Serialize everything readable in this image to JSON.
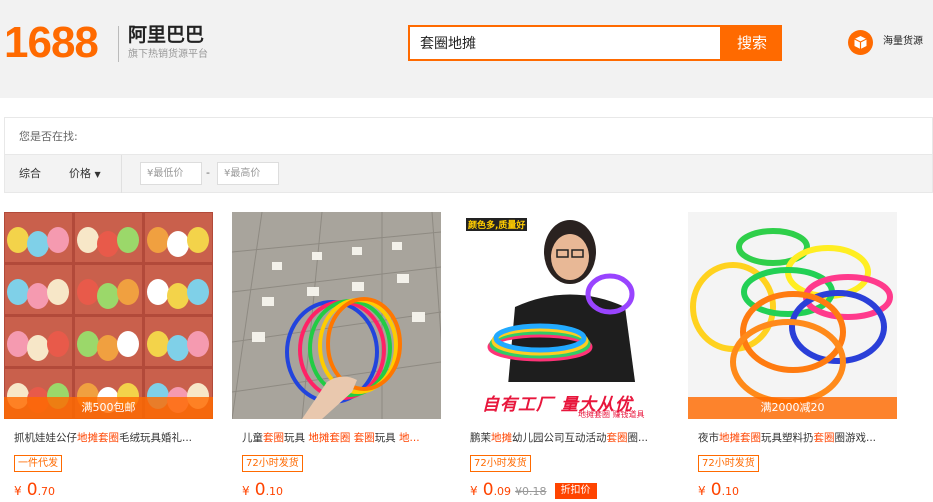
{
  "header": {
    "logo_number": "1688",
    "logo_cn": "阿里巴巴",
    "logo_sub": "旗下热销货源平台",
    "search_value": "套圈地摊",
    "search_button": "搜索",
    "supply_label": "海量货源"
  },
  "suggest": {
    "label": "您是否在找:"
  },
  "filter": {
    "sort_default": "综合",
    "sort_price": "价格",
    "min_price_placeholder": "¥最低价",
    "dash": "-",
    "max_price_placeholder": "¥最高价"
  },
  "products": [
    {
      "title_parts": [
        "抓机娃娃公仔",
        "地摊",
        "套圈",
        "毛绒玩具婚礼..."
      ],
      "tag": "一件代发",
      "price_currency": "¥",
      "price_int": "0",
      "price_dec": ".70",
      "banner": "满500包邮",
      "image_icon": "plush-toys-photo"
    },
    {
      "title_parts": [
        "儿童",
        "套圈",
        "玩具 ",
        "地摊",
        "套圈",
        " ",
        "套圈",
        "玩具 ",
        "地..."
      ],
      "tag": "72小时发货",
      "price_currency": "¥",
      "price_int": "0",
      "price_dec": ".10",
      "image_icon": "rings-in-hand-photo"
    },
    {
      "title_parts": [
        "鹏茉",
        "地摊",
        "幼儿园公司互动活动",
        "套圈",
        "圈..."
      ],
      "tag": "72小时发货",
      "price_currency": "¥",
      "price_int": "0",
      "price_dec": ".09",
      "price_old": "¥0.18",
      "badge": "折扣价",
      "img_top_text": "颜色多,质量好",
      "img_bottom_text": "自有工厂 量大从优",
      "img_bottom_sub": "地摊套圈 赚钱道具",
      "image_icon": "person-with-rings-photo"
    },
    {
      "title_parts": [
        "夜市",
        "地摊",
        "套圈",
        "玩具塑料扔",
        "套圈",
        "圈游戏..."
      ],
      "tag": "72小时发货",
      "price_currency": "¥",
      "price_int": "0",
      "price_dec": ".10",
      "banner": "满2000减20",
      "image_icon": "colorful-rings-photo"
    }
  ],
  "colors": {
    "brand": "#ff6a00",
    "highlight": "#ff4400"
  }
}
